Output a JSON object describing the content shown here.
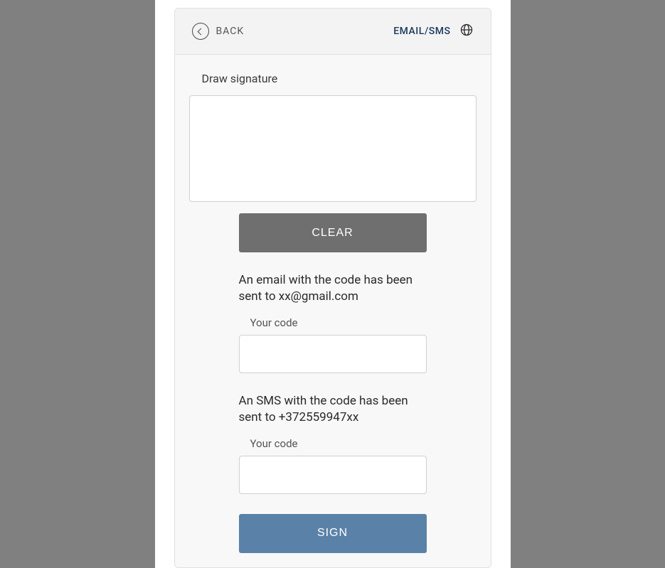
{
  "header": {
    "back_label": "BACK",
    "method_label": "EMAIL/SMS"
  },
  "signature": {
    "label": "Draw signature",
    "clear_label": "CLEAR"
  },
  "email": {
    "info": "An email with the code has been sent to xx@gmail.com",
    "code_label": "Your code"
  },
  "sms": {
    "info": "An SMS with the code has been sent to +372559947xx",
    "code_label": "Your code"
  },
  "actions": {
    "sign_label": "SIGN"
  }
}
